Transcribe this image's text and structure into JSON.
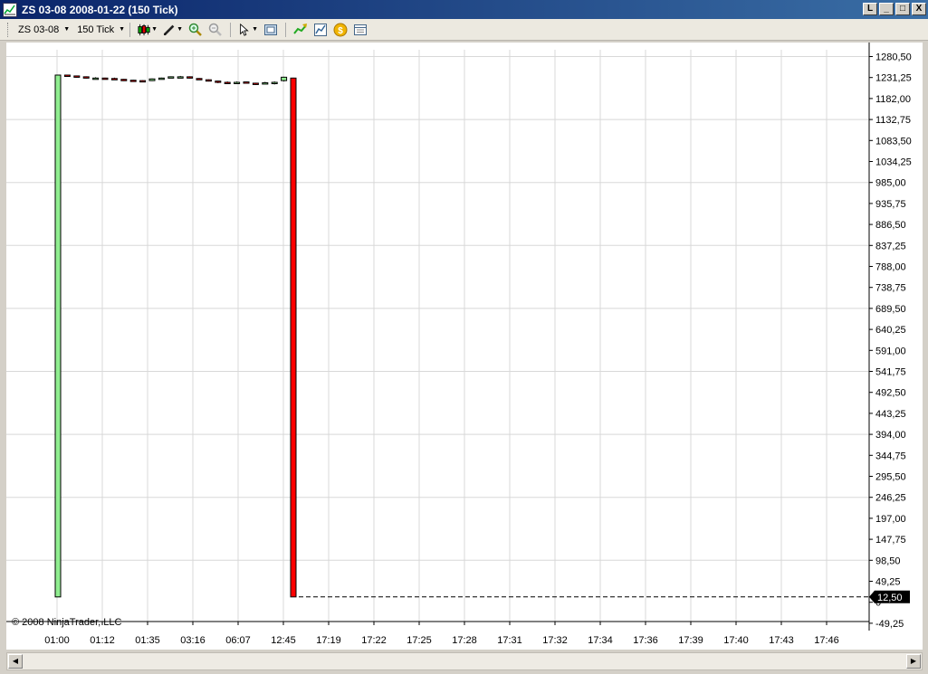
{
  "window": {
    "title": "ZS 03-08  2008-01-22  (150 Tick)",
    "buttons": [
      "L",
      "_",
      "□",
      "X"
    ]
  },
  "toolbar": {
    "instrument": "ZS 03-08",
    "interval": "150 Tick",
    "icons": [
      "candlestick-icon",
      "pencil-icon",
      "zoom-in-icon",
      "zoom-out-icon",
      "cursor-icon",
      "properties-icon",
      "indicators-icon",
      "strategies-icon",
      "order-icon",
      "data-box-icon"
    ]
  },
  "chart": {
    "copyright": "© 2008 NinjaTrader, LLC",
    "price_labels": [
      "1280,50",
      "1231,25",
      "1182,00",
      "1132,75",
      "1083,50",
      "1034,25",
      "985,00",
      "935,75",
      "886,50",
      "837,25",
      "788,00",
      "738,75",
      "689,50",
      "640,25",
      "591,00",
      "541,75",
      "492,50",
      "443,25",
      "394,00",
      "344,75",
      "295,50",
      "246,25",
      "197,00",
      "147,75",
      "98,50",
      "49,25",
      "0",
      "-49,25"
    ],
    "time_labels": [
      "01:00",
      "01:12",
      "01:35",
      "03:16",
      "06:07",
      "12:45",
      "17:19",
      "17:22",
      "17:25",
      "17:28",
      "17:31",
      "17:32",
      "17:34",
      "17:36",
      "17:39",
      "17:40",
      "17:43",
      "17:46"
    ],
    "last_price": "12,50",
    "up_color": "#90ee90",
    "down_color": "#ff0000"
  },
  "chart_data": {
    "type": "candlestick",
    "ylim": [
      -49.25,
      1280.5
    ],
    "bars": [
      {
        "open": 12.5,
        "close": 1237,
        "high": 1237,
        "low": 12.5
      },
      {
        "open": 1237,
        "close": 1235,
        "high": 1238,
        "low": 1233
      },
      {
        "open": 1235,
        "close": 1233,
        "high": 1236,
        "low": 1231
      },
      {
        "open": 1233,
        "close": 1231,
        "high": 1234,
        "low": 1229
      },
      {
        "open": 1230,
        "close": 1230,
        "high": 1232,
        "low": 1228
      },
      {
        "open": 1230,
        "close": 1229,
        "high": 1231,
        "low": 1227
      },
      {
        "open": 1229,
        "close": 1228,
        "high": 1231,
        "low": 1226
      },
      {
        "open": 1227,
        "close": 1225,
        "high": 1228,
        "low": 1223
      },
      {
        "open": 1225,
        "close": 1224,
        "high": 1226,
        "low": 1222
      },
      {
        "open": 1224,
        "close": 1223,
        "high": 1225,
        "low": 1221
      },
      {
        "open": 1224,
        "close": 1228,
        "high": 1229,
        "low": 1223
      },
      {
        "open": 1228,
        "close": 1230,
        "high": 1231,
        "low": 1227
      },
      {
        "open": 1231,
        "close": 1233,
        "high": 1234,
        "low": 1230
      },
      {
        "open": 1233,
        "close": 1233,
        "high": 1235,
        "low": 1231
      },
      {
        "open": 1233,
        "close": 1231,
        "high": 1234,
        "low": 1229
      },
      {
        "open": 1229,
        "close": 1228,
        "high": 1230,
        "low": 1226
      },
      {
        "open": 1226,
        "close": 1224,
        "high": 1227,
        "low": 1222
      },
      {
        "open": 1223,
        "close": 1220,
        "high": 1224,
        "low": 1218
      },
      {
        "open": 1220,
        "close": 1219,
        "high": 1222,
        "low": 1217
      },
      {
        "open": 1220,
        "close": 1220,
        "high": 1222,
        "low": 1218
      },
      {
        "open": 1221,
        "close": 1219,
        "high": 1222,
        "low": 1217
      },
      {
        "open": 1218,
        "close": 1216,
        "high": 1219,
        "low": 1214
      },
      {
        "open": 1218,
        "close": 1219,
        "high": 1221,
        "low": 1216
      },
      {
        "open": 1217,
        "close": 1220,
        "high": 1222,
        "low": 1215
      },
      {
        "open": 1224,
        "close": 1232,
        "high": 1233,
        "low": 1222
      },
      {
        "open": 1230,
        "close": 12.5,
        "high": 1231,
        "low": 12.5
      }
    ]
  }
}
